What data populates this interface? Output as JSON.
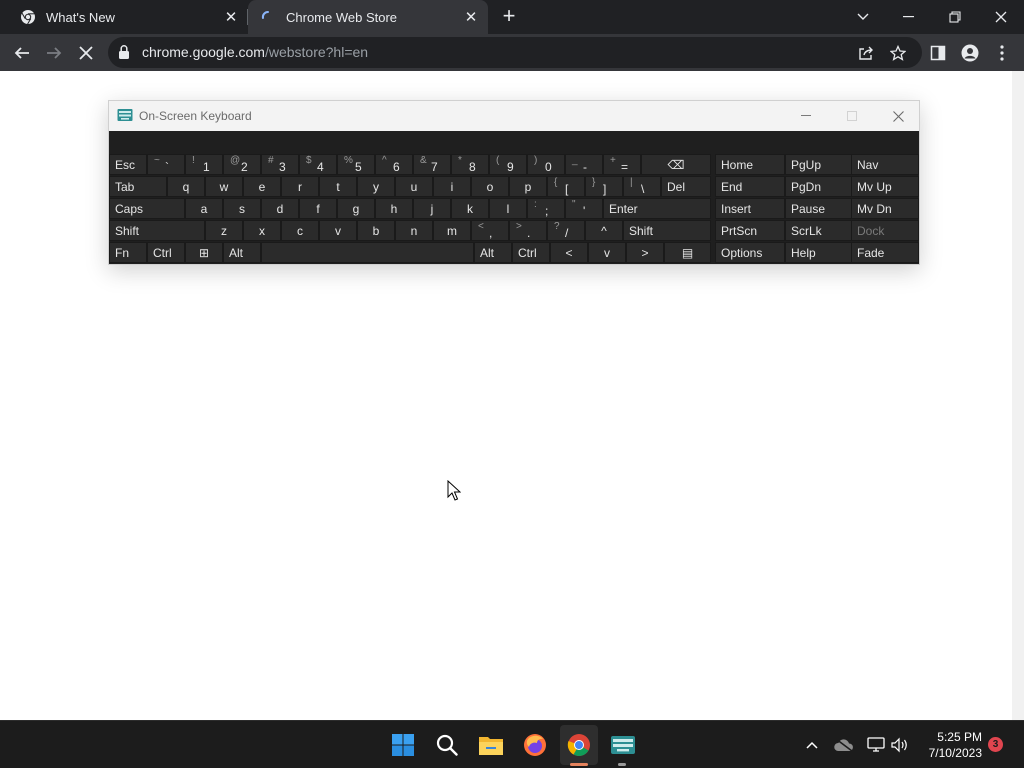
{
  "browser": {
    "tabs": [
      {
        "title": "What's New",
        "icon": "chrome-icon"
      },
      {
        "title": "Chrome Web Store",
        "icon": "loading-spinner-icon",
        "active": true
      }
    ],
    "url": {
      "host": "chrome.google.com",
      "path": "/webstore?hl=en"
    }
  },
  "osk": {
    "title": "On-Screen Keyboard",
    "rows": [
      [
        {
          "label": "Esc"
        },
        {
          "shift": "~",
          "main": "`"
        },
        {
          "shift": "!",
          "main": "1"
        },
        {
          "shift": "@",
          "main": "2"
        },
        {
          "shift": "#",
          "main": "3"
        },
        {
          "shift": "$",
          "main": "4"
        },
        {
          "shift": "%",
          "main": "5"
        },
        {
          "shift": "^",
          "main": "6"
        },
        {
          "shift": "&",
          "main": "7"
        },
        {
          "shift": "*",
          "main": "8"
        },
        {
          "shift": "(",
          "main": "9"
        },
        {
          "shift": ")",
          "main": "0"
        },
        {
          "shift": "_",
          "main": "-"
        },
        {
          "shift": "+",
          "main": "="
        },
        {
          "label": "⌫",
          "icon": "backspace-icon"
        }
      ],
      [
        {
          "label": "Tab"
        },
        {
          "label": "q"
        },
        {
          "label": "w"
        },
        {
          "label": "e"
        },
        {
          "label": "r"
        },
        {
          "label": "t"
        },
        {
          "label": "y"
        },
        {
          "label": "u"
        },
        {
          "label": "i"
        },
        {
          "label": "o"
        },
        {
          "label": "p"
        },
        {
          "shift": "{",
          "main": "["
        },
        {
          "shift": "}",
          "main": "]"
        },
        {
          "shift": "|",
          "main": "\\"
        },
        {
          "label": "Del"
        }
      ],
      [
        {
          "label": "Caps"
        },
        {
          "label": "a"
        },
        {
          "label": "s"
        },
        {
          "label": "d"
        },
        {
          "label": "f"
        },
        {
          "label": "g"
        },
        {
          "label": "h"
        },
        {
          "label": "j"
        },
        {
          "label": "k"
        },
        {
          "label": "l"
        },
        {
          "shift": ":",
          "main": ";"
        },
        {
          "shift": "\"",
          "main": "'"
        },
        {
          "label": "Enter"
        }
      ],
      [
        {
          "label": "Shift"
        },
        {
          "label": "z"
        },
        {
          "label": "x"
        },
        {
          "label": "c"
        },
        {
          "label": "v"
        },
        {
          "label": "b"
        },
        {
          "label": "n"
        },
        {
          "label": "m"
        },
        {
          "shift": "<",
          "main": ","
        },
        {
          "shift": ">",
          "main": "."
        },
        {
          "shift": "?",
          "main": "/"
        },
        {
          "label": "^",
          "icon": "arrow-up-icon"
        },
        {
          "label": "Shift"
        }
      ],
      [
        {
          "label": "Fn"
        },
        {
          "label": "Ctrl"
        },
        {
          "label": "⊞",
          "icon": "windows-icon"
        },
        {
          "label": "Alt"
        },
        {
          "label": " ",
          "icon": "spacebar"
        },
        {
          "label": "Alt"
        },
        {
          "label": "Ctrl"
        },
        {
          "label": "<",
          "icon": "arrow-left-icon"
        },
        {
          "label": "v",
          "icon": "arrow-down-icon"
        },
        {
          "label": ">",
          "icon": "arrow-right-icon"
        },
        {
          "label": "▤",
          "icon": "menu-key-icon"
        }
      ]
    ],
    "nav_rows": [
      [
        {
          "label": "Home"
        },
        {
          "label": "PgUp"
        },
        {
          "label": "Nav"
        }
      ],
      [
        {
          "label": "End"
        },
        {
          "label": "PgDn"
        },
        {
          "label": "Mv Up"
        }
      ],
      [
        {
          "label": "Insert"
        },
        {
          "label": "Pause"
        },
        {
          "label": "Mv Dn"
        }
      ],
      [
        {
          "label": "PrtScn"
        },
        {
          "label": "ScrLk"
        },
        {
          "label": "Dock",
          "dim": true
        }
      ],
      [
        {
          "label": "Options"
        },
        {
          "label": "Help"
        },
        {
          "label": "Fade"
        }
      ]
    ]
  },
  "taskbar": {
    "apps": [
      "windows-start-icon",
      "search-icon",
      "file-explorer-icon",
      "firefox-icon",
      "chrome-icon",
      "on-screen-keyboard-icon"
    ],
    "clock": {
      "time": "5:25 PM",
      "date": "7/10/2023"
    },
    "notification_count": "3"
  },
  "colors": {
    "tabstrip": "#202124",
    "toolbar": "#35363a",
    "osk_key": "#2b2b2b",
    "taskbar": "#1c1c1c",
    "badge": "#e0454f"
  }
}
